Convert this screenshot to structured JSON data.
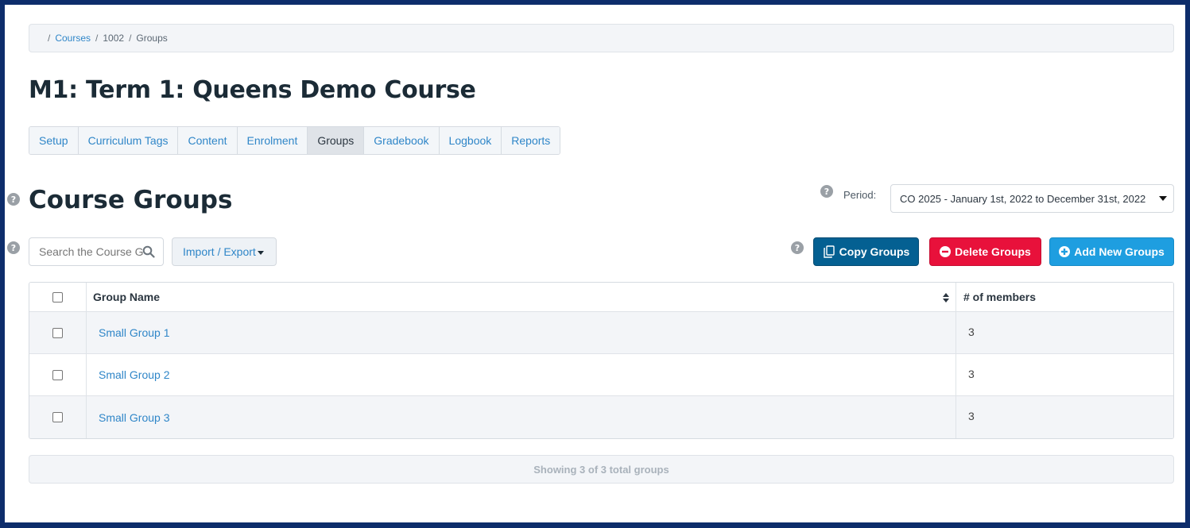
{
  "breadcrumb": {
    "items": [
      "Courses",
      "1002",
      "Groups"
    ]
  },
  "course": {
    "title": "M1: Term 1: Queens Demo Course"
  },
  "tabs": [
    {
      "label": "Setup"
    },
    {
      "label": "Curriculum Tags"
    },
    {
      "label": "Content"
    },
    {
      "label": "Enrolment"
    },
    {
      "label": "Groups",
      "active": true
    },
    {
      "label": "Gradebook"
    },
    {
      "label": "Logbook"
    },
    {
      "label": "Reports"
    }
  ],
  "section": {
    "title": "Course Groups"
  },
  "period": {
    "label": "Period:",
    "selected": "CO 2025 - January 1st, 2022 to December 31st, 2022"
  },
  "search": {
    "placeholder": "Search the Course Groups"
  },
  "toolbar": {
    "import_export": "Import / Export",
    "copy": "Copy Groups",
    "delete": "Delete Groups",
    "add": "Add New Groups"
  },
  "table": {
    "columns": [
      "Group Name",
      "# of members"
    ],
    "rows": [
      {
        "name": "Small Group 1",
        "members": "3"
      },
      {
        "name": "Small Group 2",
        "members": "3"
      },
      {
        "name": "Small Group 3",
        "members": "3"
      }
    ]
  },
  "footer": {
    "summary": "Showing 3 of 3 total groups"
  },
  "colors": {
    "frame": "#0d2d6b",
    "link": "#2f86c8",
    "copy_button": "#046092",
    "delete_button": "#e8113b",
    "add_button": "#1e9ee0"
  },
  "icons": {
    "help": "question-circle-icon",
    "search": "search-icon",
    "copy": "copy-icon",
    "delete": "minus-circle-icon",
    "add": "plus-circle-icon",
    "sort": "sort-icon"
  }
}
